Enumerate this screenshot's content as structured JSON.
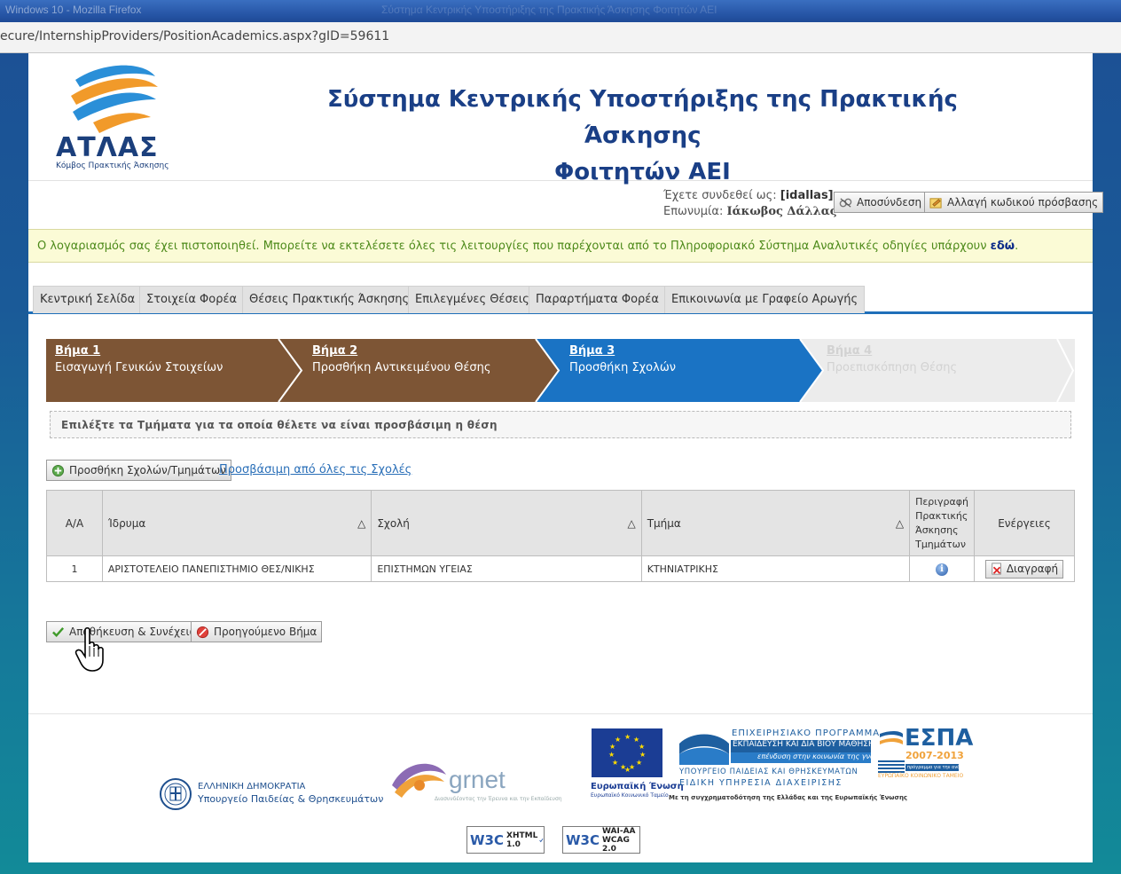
{
  "browser": {
    "title": "Windows 10 - Mozilla Firefox",
    "title_right": "Σύστημα Κεντρικής Υποστήριξης της Πρακτικής Άσκησης Φοιτητών ΑΕΙ",
    "url": "ecure/InternshipProviders/PositionAcademics.aspx?gID=59611"
  },
  "header": {
    "logo_text": "ΑΤΛΑΣ",
    "logo_sub": "Κόμβος Πρακτικής Άσκησης",
    "title_line1": "Σύστημα Κεντρικής Υποστήριξης της Πρακτικής Άσκησης",
    "title_line2": "Φοιτητών ΑΕΙ"
  },
  "user": {
    "logged_in_label": "Έχετε συνδεθεί ως:",
    "username": "[idallas]",
    "name_label": "Επωνυμία:",
    "name_value": "Ιάκωβος Δάλλας",
    "logout_label": "Αποσύνδεση",
    "change_password_label": "Αλλαγή κωδικού πρόσβασης"
  },
  "notice": {
    "text": "Ο λογαριασμός σας έχει πιστοποιηθεί. Μπορείτε να εκτελέσετε όλες τις λειτουργίες που παρέχονται από το Πληροφοριακό Σύστημα Αναλυτικές οδηγίες υπάρχουν ",
    "link": "εδώ",
    "end": "."
  },
  "tabs": [
    {
      "label": "Κεντρική Σελίδα"
    },
    {
      "label": "Στοιχεία Φορέα"
    },
    {
      "label": "Θέσεις Πρακτικής Άσκησης"
    },
    {
      "label": "Επιλεγμένες Θέσεις"
    },
    {
      "label": "Παραρτήματα Φορέα"
    },
    {
      "label": "Επικοινωνία με Γραφείο Αρωγής"
    }
  ],
  "wizard": [
    {
      "label": "Βήμα 1",
      "desc": "Εισαγωγή Γενικών Στοιχείων",
      "state": "done"
    },
    {
      "label": "Βήμα 2",
      "desc": "Προσθήκη Αντικειμένου Θέσης",
      "state": "done"
    },
    {
      "label": "Βήμα 3",
      "desc": "Προσθήκη Σχολών",
      "state": "active"
    },
    {
      "label": "Βήμα 4",
      "desc": "Προεπισκόπηση Θέσης",
      "state": "disabled"
    }
  ],
  "instructions": "Επιλέξτε τα Τμήματα για τα οποία θέλετε να είναι προσβάσιμη η θέση",
  "actions": {
    "add_label": "Προσθήκη Σχολών/Τμημάτων",
    "all_link": "Προσβάσιμη από όλες τις Σχολές",
    "save_label": "Αποθήκευση & Συνέχεια",
    "back_label": "Προηγούμενο Βήμα"
  },
  "table": {
    "headers": {
      "aa": "Α/Α",
      "institution": "Ίδρυμα",
      "school": "Σχολή",
      "department": "Τμήμα",
      "description_1": "Περιγραφή",
      "description_2": "Πρακτικής",
      "description_3": "Άσκησης",
      "description_4": "Τμημάτων",
      "actions": "Ενέργειες"
    },
    "sort_glyph": "△",
    "rows": [
      {
        "aa": "1",
        "institution": "ΑΡΙΣΤΟΤΕΛΕΙΟ ΠΑΝΕΠΙΣΤΗΜΙΟ ΘΕΣ/ΝΙΚΗΣ",
        "school": "ΕΠΙΣΤΗΜΩΝ ΥΓΕΙΑΣ",
        "department": "ΚΤΗΝΙΑΤΡΙΚΗΣ",
        "delete_label": "Διαγραφή"
      }
    ]
  },
  "footer": {
    "ministry_line1": "ΕΛΛΗΝΙΚΗ ΔΗΜΟΚΡΑΤΙΑ",
    "ministry_line2": "Υπουργείο Παιδείας & Θρησκευμάτων",
    "grnet": "grnet",
    "grnet_sub": "Διασυνδέοντας την Έρευνα και την Εκπαίδευση",
    "eu_line1": "Ευρωπαϊκή Ένωση",
    "eu_line2": "Ευρωπαϊκό Κοινωνικό Ταμείο",
    "op_line1": "ΕΠΙΧΕΙΡΗΣΙΑΚΟ ΠΡΟΓΡΑΜΜΑ",
    "op_line2": "ΕΚΠΑΙΔΕΥΣΗ ΚΑΙ ΔΙΑ ΒΙΟΥ ΜΑΘΗΣΗ",
    "op_line3": "επένδυση στην κοινωνία της γνώσης",
    "op_line4": "ΥΠΟΥΡΓΕΙΟ ΠΑΙΔΕΙΑΣ ΚΑΙ ΘΡΗΣΚΕΥΜΑΤΩΝ",
    "op_line5": "ΕΙΔΙΚΗ ΥΠΗΡΕΣΙΑ ΔΙΑΧΕΙΡΙΣΗΣ",
    "cofund": "Με τη συγχρηματοδότηση της Ελλάδας και της Ευρωπαϊκής Ένωσης",
    "espa": "ΕΣΠΑ",
    "espa_years": "2007-2013",
    "espa_sub": "πρόγραμμα για την ανάπτυξη",
    "espa_fund": "ΕΥΡΩΠΑΪΚΟ ΚΟΙΝΩΝΙΚΟ ΤΑΜΕΙΟ",
    "w3c1_a": "W3C",
    "w3c1_b": "XHTML",
    "w3c1_c": "1.0",
    "w3c2_a": "W3C",
    "w3c2_b": "WAI-AA",
    "w3c2_c": "WCAG 2.0"
  },
  "colors": {
    "brand_blue": "#1a3f86",
    "step_done": "#7d5535",
    "step_active": "#1a73c4",
    "step_disabled": "#ececec",
    "tab_underline": "#1f6fb9",
    "notice_bg": "#fbfbd6",
    "notice_text": "#4d8a1a"
  }
}
